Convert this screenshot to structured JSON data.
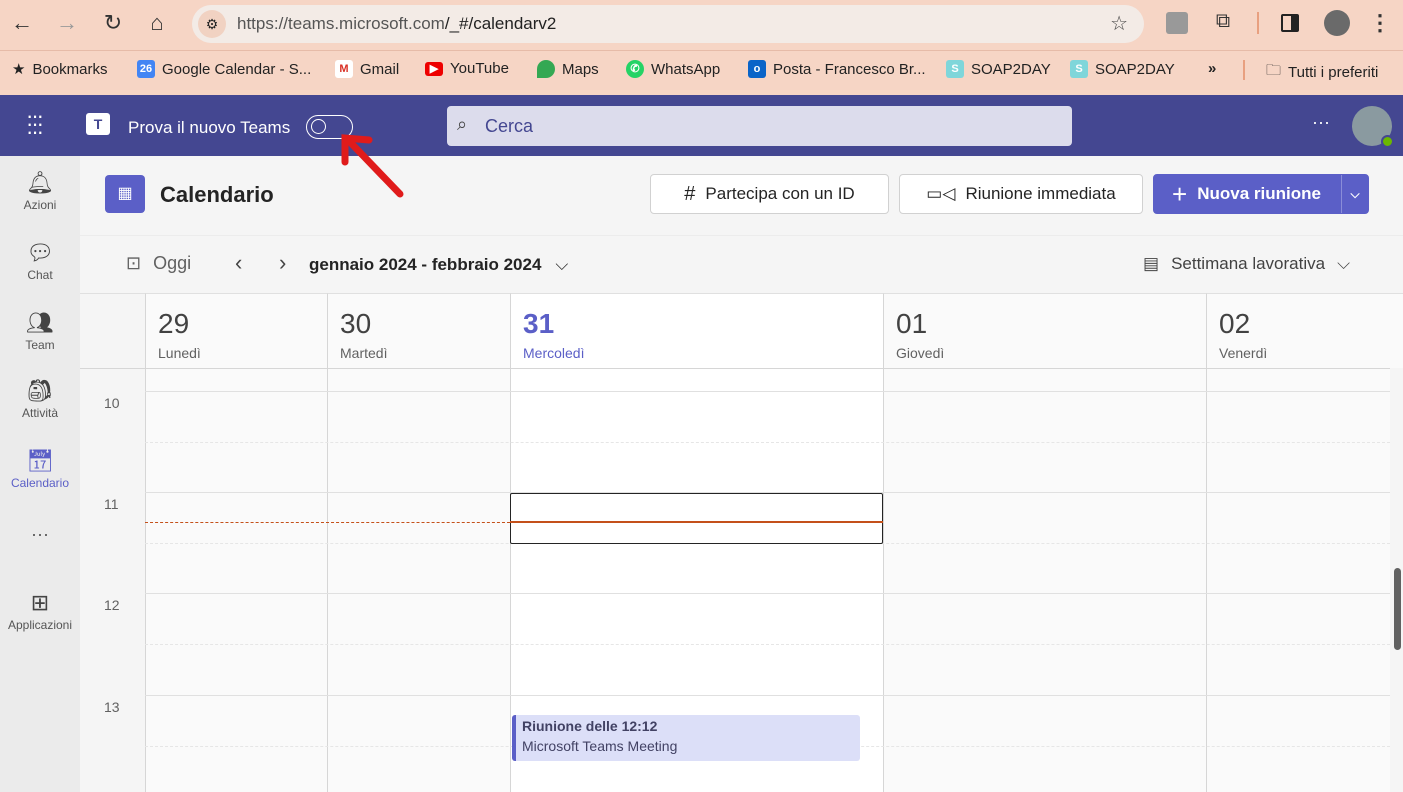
{
  "browser": {
    "url_host": "https://teams.microsoft.com",
    "url_path": "/_#/calendarv2",
    "bookmarks": [
      {
        "label": "Bookmarks",
        "icon": "star-icon"
      },
      {
        "label": "Google Calendar - S...",
        "icon": "google-calendar-icon"
      },
      {
        "label": "Gmail",
        "icon": "gmail-icon"
      },
      {
        "label": "YouTube",
        "icon": "youtube-icon"
      },
      {
        "label": "Maps",
        "icon": "maps-icon"
      },
      {
        "label": "WhatsApp",
        "icon": "whatsapp-icon"
      },
      {
        "label": "Posta - Francesco Br...",
        "icon": "outlook-icon"
      },
      {
        "label": "SOAP2DAY",
        "icon": "s-icon"
      },
      {
        "label": "SOAP2DAY",
        "icon": "s-icon"
      }
    ],
    "more": "»",
    "all_bookmarks": "Tutti i preferiti"
  },
  "teams": {
    "try_new": "Prova il nuovo Teams",
    "search_placeholder": "Cerca",
    "more": "···",
    "accent": "#444791",
    "brand": "#5b5fc7"
  },
  "rail": [
    {
      "label": "Azioni",
      "icon": "bell-icon"
    },
    {
      "label": "Chat",
      "icon": "chat-icon"
    },
    {
      "label": "Team",
      "icon": "team-icon"
    },
    {
      "label": "Attività",
      "icon": "backpack-icon"
    },
    {
      "label": "Calendario",
      "icon": "calendar-icon",
      "active": true
    },
    {
      "label": "···",
      "icon": "more-icon"
    },
    {
      "label": "Applicazioni",
      "icon": "apps-icon"
    }
  ],
  "calendar": {
    "title": "Calendario",
    "join_id": "Partecipa con un ID",
    "meet_now": "Riunione immediata",
    "new_meeting": "Nuova riunione",
    "today": "Oggi",
    "range": "gennaio 2024 - febbraio 2024",
    "view": "Settimana lavorativa",
    "days": [
      {
        "num": "29",
        "name": "Lunedì"
      },
      {
        "num": "30",
        "name": "Martedì"
      },
      {
        "num": "31",
        "name": "Mercoledì",
        "today": true
      },
      {
        "num": "01",
        "name": "Giovedì"
      },
      {
        "num": "02",
        "name": "Venerdì"
      }
    ],
    "hours": [
      "10",
      "11",
      "12",
      "13"
    ],
    "event": {
      "title": "Riunione delle 12:12",
      "subtitle": "Microsoft Teams Meeting"
    }
  }
}
